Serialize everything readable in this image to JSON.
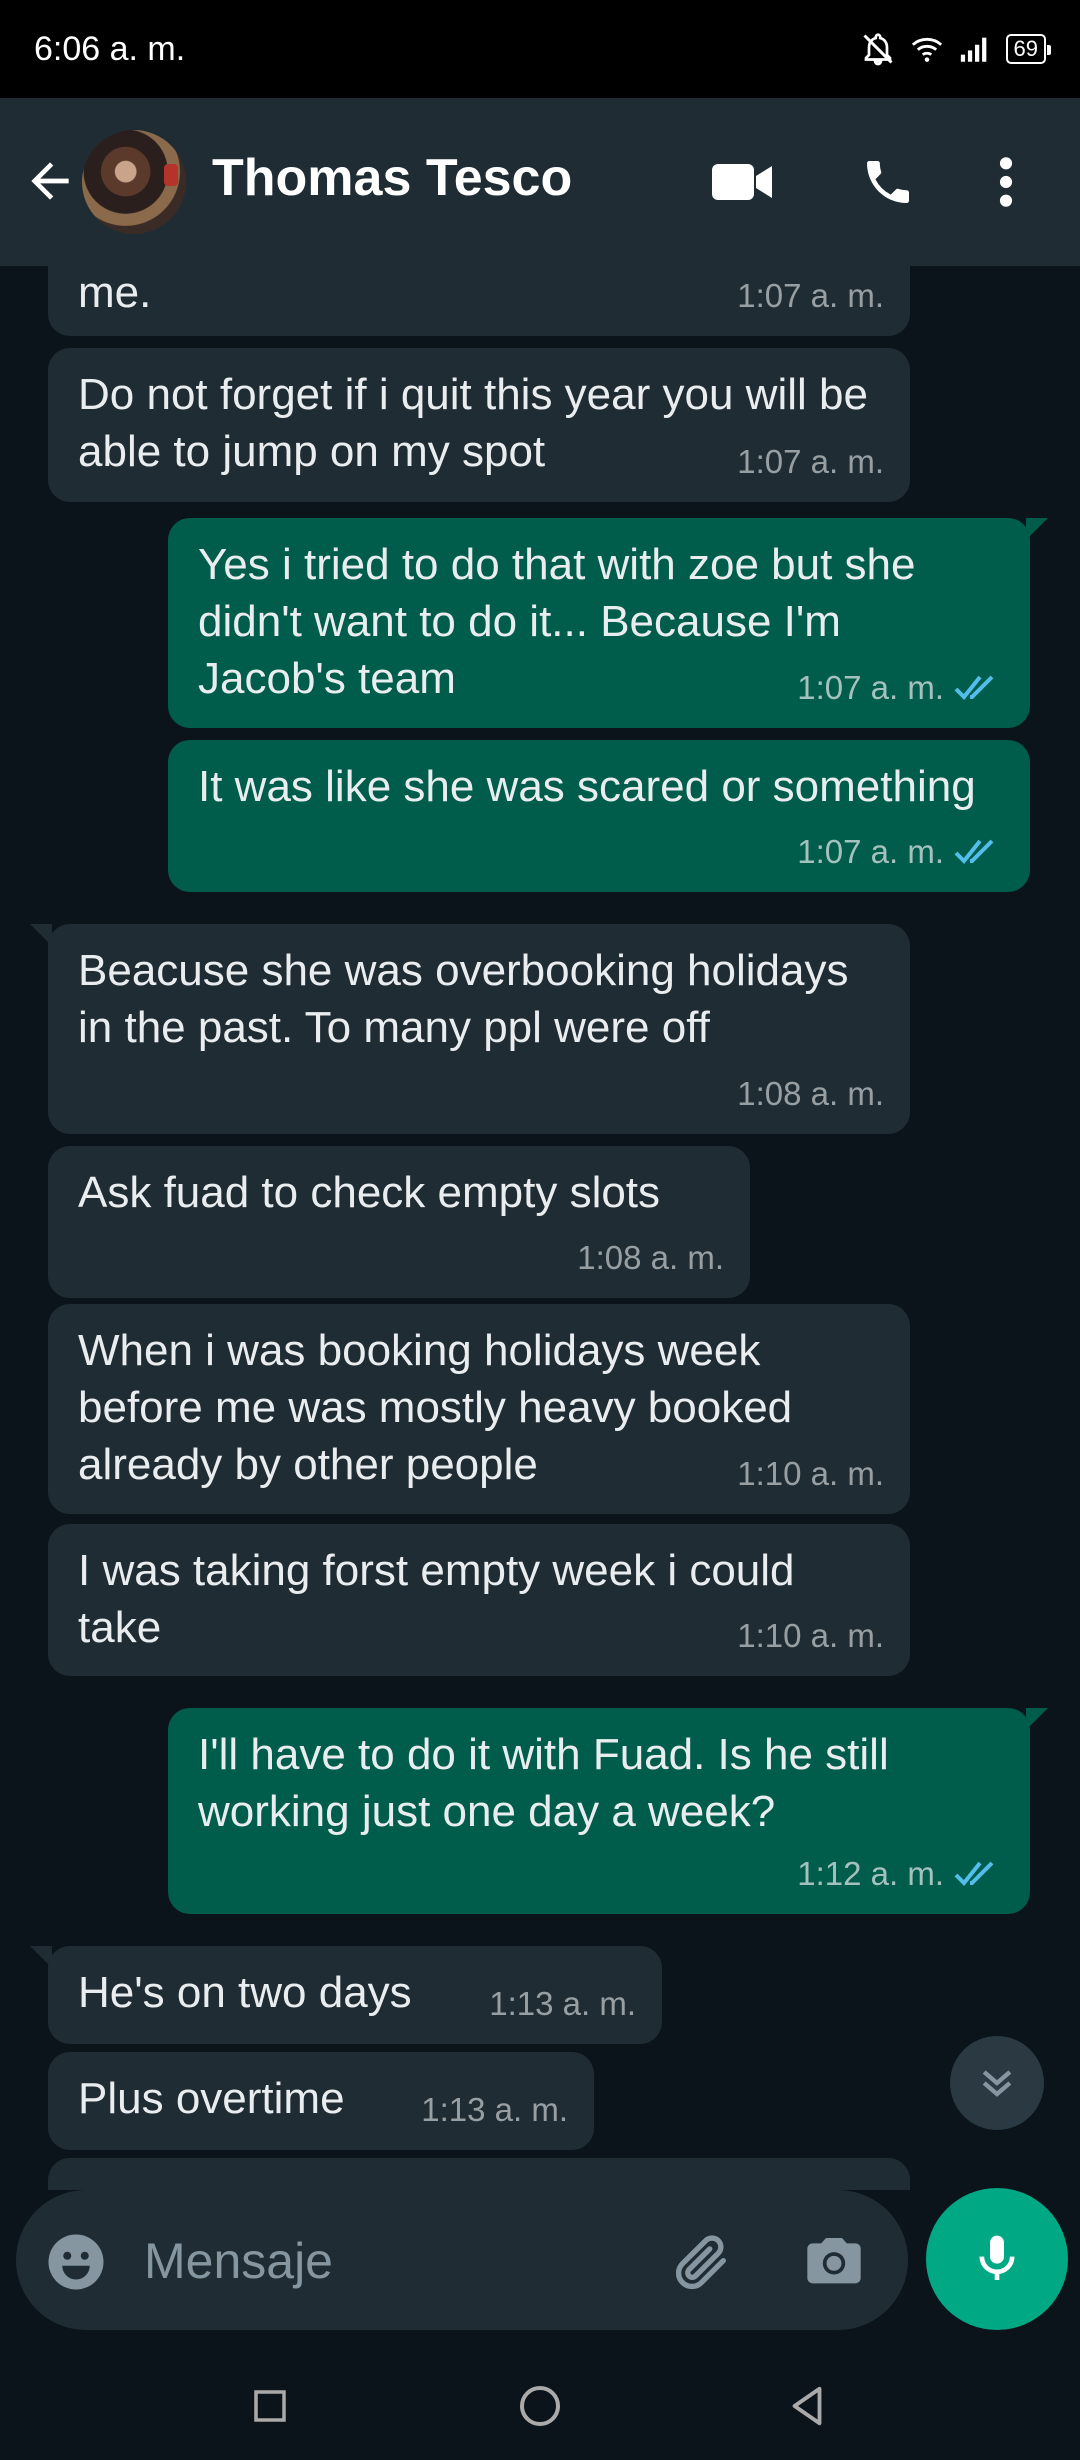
{
  "status_bar": {
    "time": "6:06 a. m.",
    "battery": "69"
  },
  "header": {
    "contact_name": "Thomas Tesco"
  },
  "messages": [
    {
      "dir": "in",
      "text": "me.",
      "time": "1:07 a. m."
    },
    {
      "dir": "in",
      "text": "Do not forget if i quit this year you will be able to jump on my spot",
      "time": "1:07 a. m."
    },
    {
      "dir": "out",
      "text": "Yes i tried to do that with zoe but she didn't want to do it... Because I'm Jacob's team",
      "time": "1:07 a. m.",
      "read": true
    },
    {
      "dir": "out",
      "text": "It was like she was scared or something",
      "time": "1:07 a. m.",
      "read": true
    },
    {
      "dir": "in",
      "text": "Beacuse she was overbooking holidays in the past. To many ppl were off",
      "time": "1:08 a. m."
    },
    {
      "dir": "in",
      "text": "Ask fuad to check empty slots",
      "time": "1:08 a. m."
    },
    {
      "dir": "in",
      "text": "When i was booking holidays week before me was mostly heavy booked already by other people",
      "time": "1:10 a. m."
    },
    {
      "dir": "in",
      "text": "I was taking forst empty week i could take",
      "time": "1:10 a. m."
    },
    {
      "dir": "out",
      "text": "I'll have to do it with Fuad. Is he still working just one day a week?",
      "time": "1:12 a. m.",
      "read": true
    },
    {
      "dir": "in",
      "text": "He's on two days",
      "time": "1:13 a. m."
    },
    {
      "dir": "in",
      "text": "Plus overtime",
      "time": "1:13 a. m."
    }
  ],
  "composer": {
    "placeholder": "Mensaje"
  },
  "colors": {
    "incoming": "#202c33",
    "outgoing": "#005c4b",
    "accent": "#00a884",
    "read_ticks": "#53bdeb"
  },
  "icons": [
    "back-arrow-icon",
    "video-call-icon",
    "phone-icon",
    "more-vert-icon",
    "scroll-down-icon",
    "emoji-icon",
    "attach-icon",
    "camera-icon",
    "mic-icon",
    "nav-recent-icon",
    "nav-home-icon",
    "nav-back-icon",
    "mute-icon",
    "wifi-icon",
    "signal-icon",
    "battery-icon"
  ]
}
